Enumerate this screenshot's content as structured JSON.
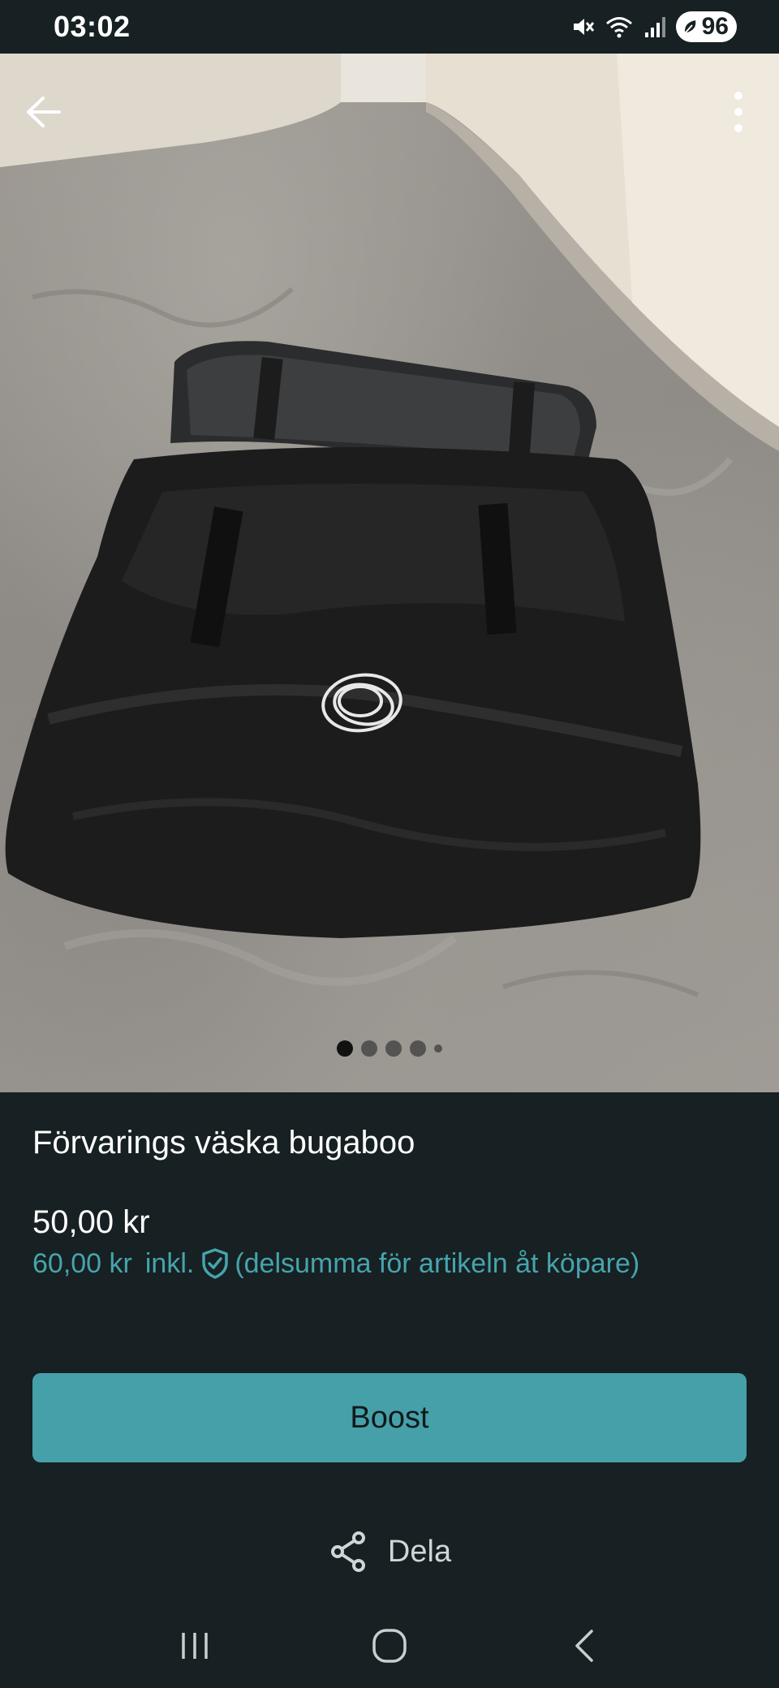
{
  "status_bar": {
    "time": "03:02",
    "battery": "96",
    "icons": [
      "mute-icon",
      "wifi-icon",
      "signal-icon",
      "battery-icon"
    ]
  },
  "photo": {
    "back_icon": "arrow-left-icon",
    "more_icon": "more-vertical-icon",
    "pager": {
      "total": 5,
      "active_index": 0
    }
  },
  "listing": {
    "title": "Förvarings väska bugaboo",
    "price": "50,00 kr",
    "total_price": "60,00 kr",
    "incl_label": "inkl.",
    "protection_note": "(delsumma för artikeln åt köpare)"
  },
  "actions": {
    "boost_label": "Boost",
    "share_label": "Dela"
  },
  "colors": {
    "background": "#172022",
    "accent": "#46a0a9",
    "accent_text": "#46a4ad"
  }
}
